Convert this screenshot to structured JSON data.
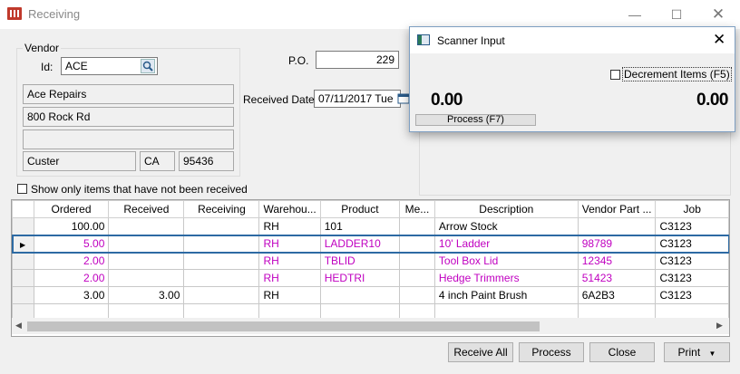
{
  "window": {
    "title": "Receiving"
  },
  "vendor": {
    "group_label": "Vendor",
    "id_label": "Id:",
    "id_value": "ACE",
    "name": "Ace Repairs",
    "address1": "800 Rock Rd",
    "address2": "",
    "city": "Custer",
    "state": "CA",
    "zip": "95436"
  },
  "po": {
    "label": "P.O.",
    "value": "229"
  },
  "received_date": {
    "label": "Received Date:",
    "value": "07/11/2017 Tue"
  },
  "show_unreceived": {
    "label": "Show only items that have not been received",
    "checked": false
  },
  "grid": {
    "columns": [
      "Ordered",
      "Received",
      "Receiving",
      "Warehou...",
      "Product",
      "Me...",
      "Description",
      "Vendor Part ...",
      "Job"
    ],
    "rows": [
      {
        "ordered": "100.00",
        "received": "",
        "receiving": "",
        "warehouse": "RH",
        "product": "101",
        "me": "",
        "description": "Arrow Stock",
        "vendor_part": "",
        "job": "C3123",
        "highlight": false,
        "selected": false
      },
      {
        "ordered": "5.00",
        "received": "",
        "receiving": "",
        "warehouse": "RH",
        "product": "LADDER10",
        "me": "",
        "description": "10' Ladder",
        "vendor_part": "98789",
        "job": "C3123",
        "highlight": true,
        "selected": true
      },
      {
        "ordered": "2.00",
        "received": "",
        "receiving": "",
        "warehouse": "RH",
        "product": "TBLID",
        "me": "",
        "description": "Tool Box Lid",
        "vendor_part": "12345",
        "job": "C3123",
        "highlight": true,
        "selected": false
      },
      {
        "ordered": "2.00",
        "received": "",
        "receiving": "",
        "warehouse": "RH",
        "product": "HEDTRI",
        "me": "",
        "description": "Hedge Trimmers",
        "vendor_part": "51423",
        "job": "C3123",
        "highlight": true,
        "selected": false
      },
      {
        "ordered": "3.00",
        "received": "3.00",
        "receiving": "",
        "warehouse": "RH",
        "product": "",
        "me": "",
        "description": "4 inch Paint Brush",
        "vendor_part": "6A2B3",
        "job": "C3123",
        "highlight": false,
        "selected": false
      }
    ]
  },
  "buttons": {
    "receive_all": "Receive All",
    "process": "Process",
    "close": "Close",
    "print": "Print"
  },
  "scanner": {
    "title": "Scanner Input",
    "decrement_label": "Decrement Items (F5)",
    "left_value": "0.00",
    "right_value": "0.00",
    "process_label": "Process (F7)"
  },
  "colors": {
    "highlight_text": "#c000c0",
    "selection_border": "#2d6aa3"
  },
  "icons": {
    "lookup": "magnifier-icon",
    "calendar": "calendar-icon",
    "app": "app-logo-icon"
  }
}
